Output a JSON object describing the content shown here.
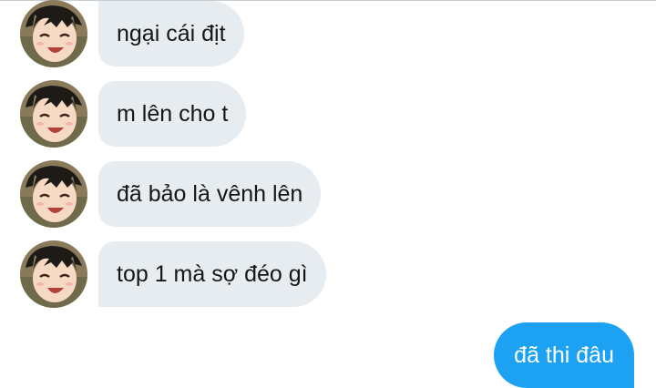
{
  "conversation": {
    "incoming": [
      {
        "text": "ngại cái địt",
        "avatar_icon": "anime-boy-avatar"
      },
      {
        "text": "m lên cho t",
        "avatar_icon": "anime-boy-avatar"
      },
      {
        "text": "đã bảo là vênh lên",
        "avatar_icon": "anime-boy-avatar"
      },
      {
        "text": "top 1 mà sợ đéo gì",
        "avatar_icon": "anime-boy-avatar"
      }
    ],
    "outgoing": [
      {
        "text": "đã thi đâu"
      }
    ]
  },
  "colors": {
    "incoming_bubble": "#e6ecf0",
    "outgoing_bubble": "#1da1f2",
    "incoming_text": "#14171a",
    "outgoing_text": "#ffffff"
  }
}
